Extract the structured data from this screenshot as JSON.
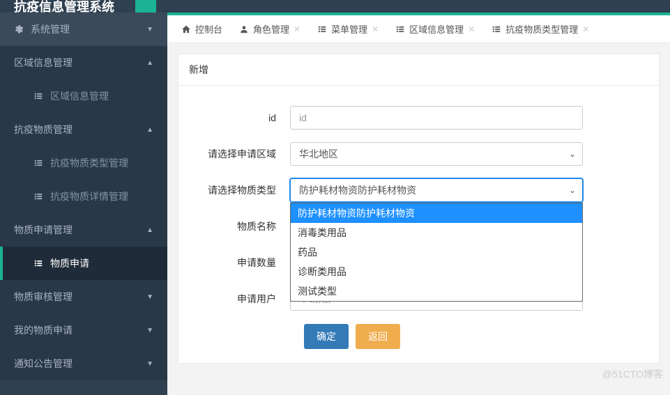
{
  "app_title": "抗疫信息管理系统",
  "sidebar": {
    "items": [
      {
        "label": "系统管理",
        "icon": "gear",
        "caret": "down"
      },
      {
        "label": "区域信息管理",
        "icon": "",
        "caret": "up"
      },
      {
        "label": "区域信息管理",
        "icon": "list",
        "sub": true
      },
      {
        "label": "抗疫物质管理",
        "icon": "",
        "caret": "up"
      },
      {
        "label": "抗疫物质类型管理",
        "icon": "list",
        "sub": true
      },
      {
        "label": "抗疫物质详情管理",
        "icon": "list",
        "sub": true
      },
      {
        "label": "物质申请管理",
        "icon": "",
        "caret": "up"
      },
      {
        "label": "物质申请",
        "icon": "list",
        "sub": true,
        "active": true
      },
      {
        "label": "物质审核管理",
        "icon": "",
        "caret": "down"
      },
      {
        "label": "我的物质申请",
        "icon": "",
        "caret": "down"
      },
      {
        "label": "通知公告管理",
        "icon": "",
        "caret": "down"
      }
    ]
  },
  "tabs": [
    {
      "label": "控制台",
      "icon": "home",
      "closable": false
    },
    {
      "label": "角色管理",
      "icon": "user",
      "closable": true
    },
    {
      "label": "菜单管理",
      "icon": "list",
      "closable": true
    },
    {
      "label": "区域信息管理",
      "icon": "list",
      "closable": true
    },
    {
      "label": "抗疫物质类型管理",
      "icon": "list",
      "closable": true
    }
  ],
  "panel": {
    "title": "新增"
  },
  "form": {
    "id": {
      "label": "id",
      "placeholder": "id",
      "value": ""
    },
    "region": {
      "label": "请选择申请区域",
      "value": "华北地区"
    },
    "material_type": {
      "label": "请选择物质类型",
      "value": "防护耗材物资防护耗材物资",
      "options": [
        "防护耗材物资防护耗材物资",
        "消毒类用品",
        "药品",
        "诊断类用品",
        "测试类型"
      ]
    },
    "name": {
      "label": "物质名称"
    },
    "quantity": {
      "label": "申请数量"
    },
    "user": {
      "label": "申请用户",
      "placeholder": "申请用户",
      "value": ""
    },
    "submit": "确定",
    "back": "返回"
  },
  "watermark": "@51CTO博客"
}
